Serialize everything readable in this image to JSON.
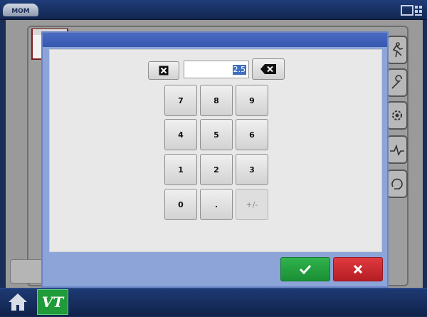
{
  "topbar": {
    "logo_text": "MOM",
    "logo_icon": "brand-logo-icon",
    "display_icon": "display-toggle-icon"
  },
  "keypad": {
    "clear_icon": "clear-x-icon",
    "backspace_icon": "backspace-icon",
    "value": "2.5",
    "keys": [
      "7",
      "8",
      "9",
      "4",
      "5",
      "6",
      "1",
      "2",
      "3",
      "0",
      ".",
      "+/-"
    ],
    "disabled_keys": [
      "+/-"
    ]
  },
  "actions": {
    "confirm_icon": "checkmark-icon",
    "cancel_icon": "close-icon",
    "confirm_color": "#1fa03c",
    "cancel_color": "#cc2229"
  },
  "bottombar": {
    "home_icon": "home-icon",
    "vt_label": "VT"
  },
  "colors": {
    "dialog_frame": "#8da4d8",
    "dialog_header": "#3658b0",
    "topbar": "#1f3d7a"
  }
}
